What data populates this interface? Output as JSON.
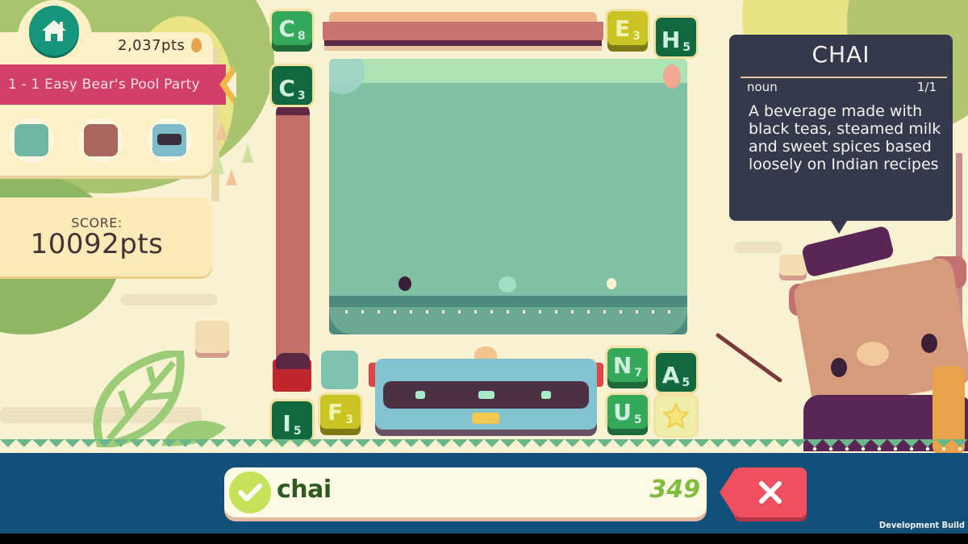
{
  "hud": {
    "home_icon": "home-icon",
    "points": "2,037pts",
    "currency_icon": "egg-icon",
    "level_title": "1 - 1 Easy Bear's Pool Party",
    "characters": [
      {
        "name": "zombie-character",
        "color": "#6fb6a5"
      },
      {
        "name": "bear-character",
        "color": "#a8685f"
      },
      {
        "name": "robot-character",
        "color": "#7fbccb"
      }
    ]
  },
  "score": {
    "label": "SCORE:",
    "value": "10092pts"
  },
  "tiles": [
    {
      "id": "c8",
      "letter": "C",
      "points": "8",
      "style": "raised"
    },
    {
      "id": "e3",
      "letter": "E",
      "points": "3",
      "style": "yellow"
    },
    {
      "id": "h5",
      "letter": "H",
      "points": "5",
      "style": "flat"
    },
    {
      "id": "c3",
      "letter": "C",
      "points": "3",
      "style": "flat"
    },
    {
      "id": "n7",
      "letter": "N",
      "points": "7",
      "style": "raised"
    },
    {
      "id": "a5",
      "letter": "A",
      "points": "5",
      "style": "flat"
    },
    {
      "id": "i5",
      "letter": "I",
      "points": "5",
      "style": "flat"
    },
    {
      "id": "f3",
      "letter": "F",
      "points": "3",
      "style": "yellow"
    },
    {
      "id": "u5",
      "letter": "U",
      "points": "5",
      "style": "raised"
    },
    {
      "id": "star",
      "letter": "",
      "points": "",
      "style": "star"
    }
  ],
  "definition": {
    "word": "CHAI",
    "part_of_speech": "noun",
    "count": "1/1",
    "text": "A beverage made with black teas, steamed milk and sweet spices based loosely on Indian recipes"
  },
  "word_bar": {
    "word": "chai",
    "word_score": "349",
    "submit_icon": "check-icon",
    "clear_icon": "close-icon"
  },
  "build_label": "Development Build",
  "colors": {
    "accent_green": "#34a85b",
    "banner_pink": "#d2406a",
    "bottom_bar": "#12507a",
    "clear_red": "#ee5060"
  }
}
